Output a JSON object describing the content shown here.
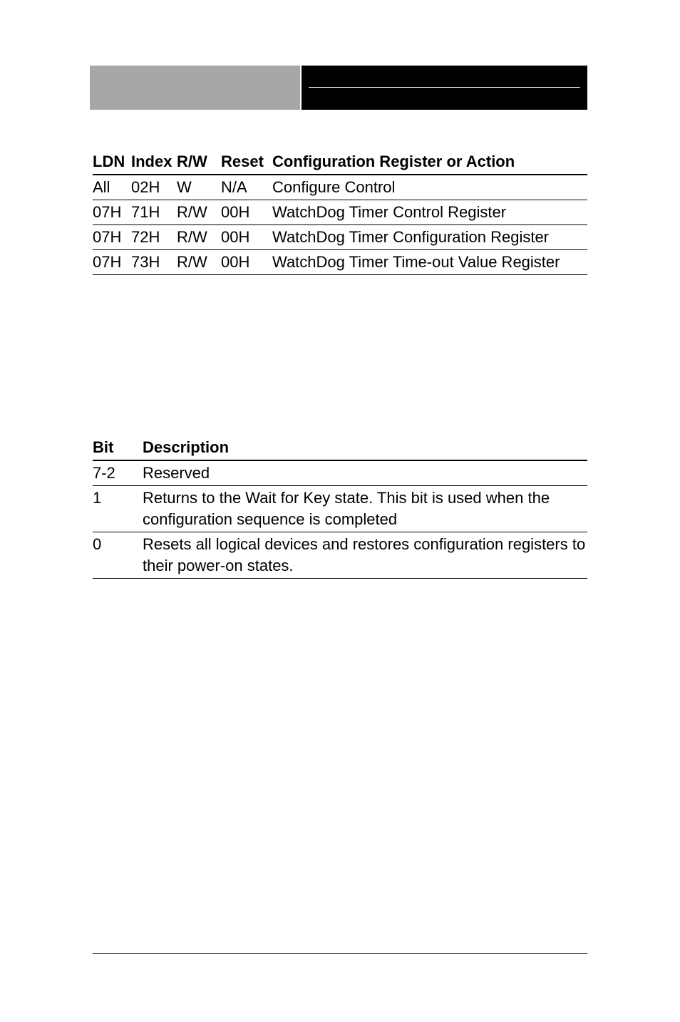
{
  "table1": {
    "headers": {
      "ldn": "LDN",
      "index": "Index",
      "rw": "R/W",
      "reset": "Reset",
      "action": "Configuration Register or Action"
    },
    "rows": [
      {
        "ldn": "All",
        "index": "02H",
        "rw": "W",
        "reset": "N/A",
        "action": "Configure Control"
      },
      {
        "ldn": "07H",
        "index": "71H",
        "rw": "R/W",
        "reset": "00H",
        "action": "WatchDog Timer Control Register"
      },
      {
        "ldn": "07H",
        "index": "72H",
        "rw": "R/W",
        "reset": "00H",
        "action": "WatchDog Timer Configuration Register"
      },
      {
        "ldn": "07H",
        "index": "73H",
        "rw": "R/W",
        "reset": "00H",
        "action": "WatchDog Timer Time-out Value Register"
      }
    ]
  },
  "table2": {
    "headers": {
      "bit": "Bit",
      "desc": "Description"
    },
    "rows": [
      {
        "bit": "7-2",
        "desc": "Reserved"
      },
      {
        "bit": "1",
        "desc": "Returns to the Wait for Key state. This bit is used when the configuration sequence is completed"
      },
      {
        "bit": "0",
        "desc": "Resets all logical devices and restores configuration registers to their power-on states."
      }
    ]
  }
}
